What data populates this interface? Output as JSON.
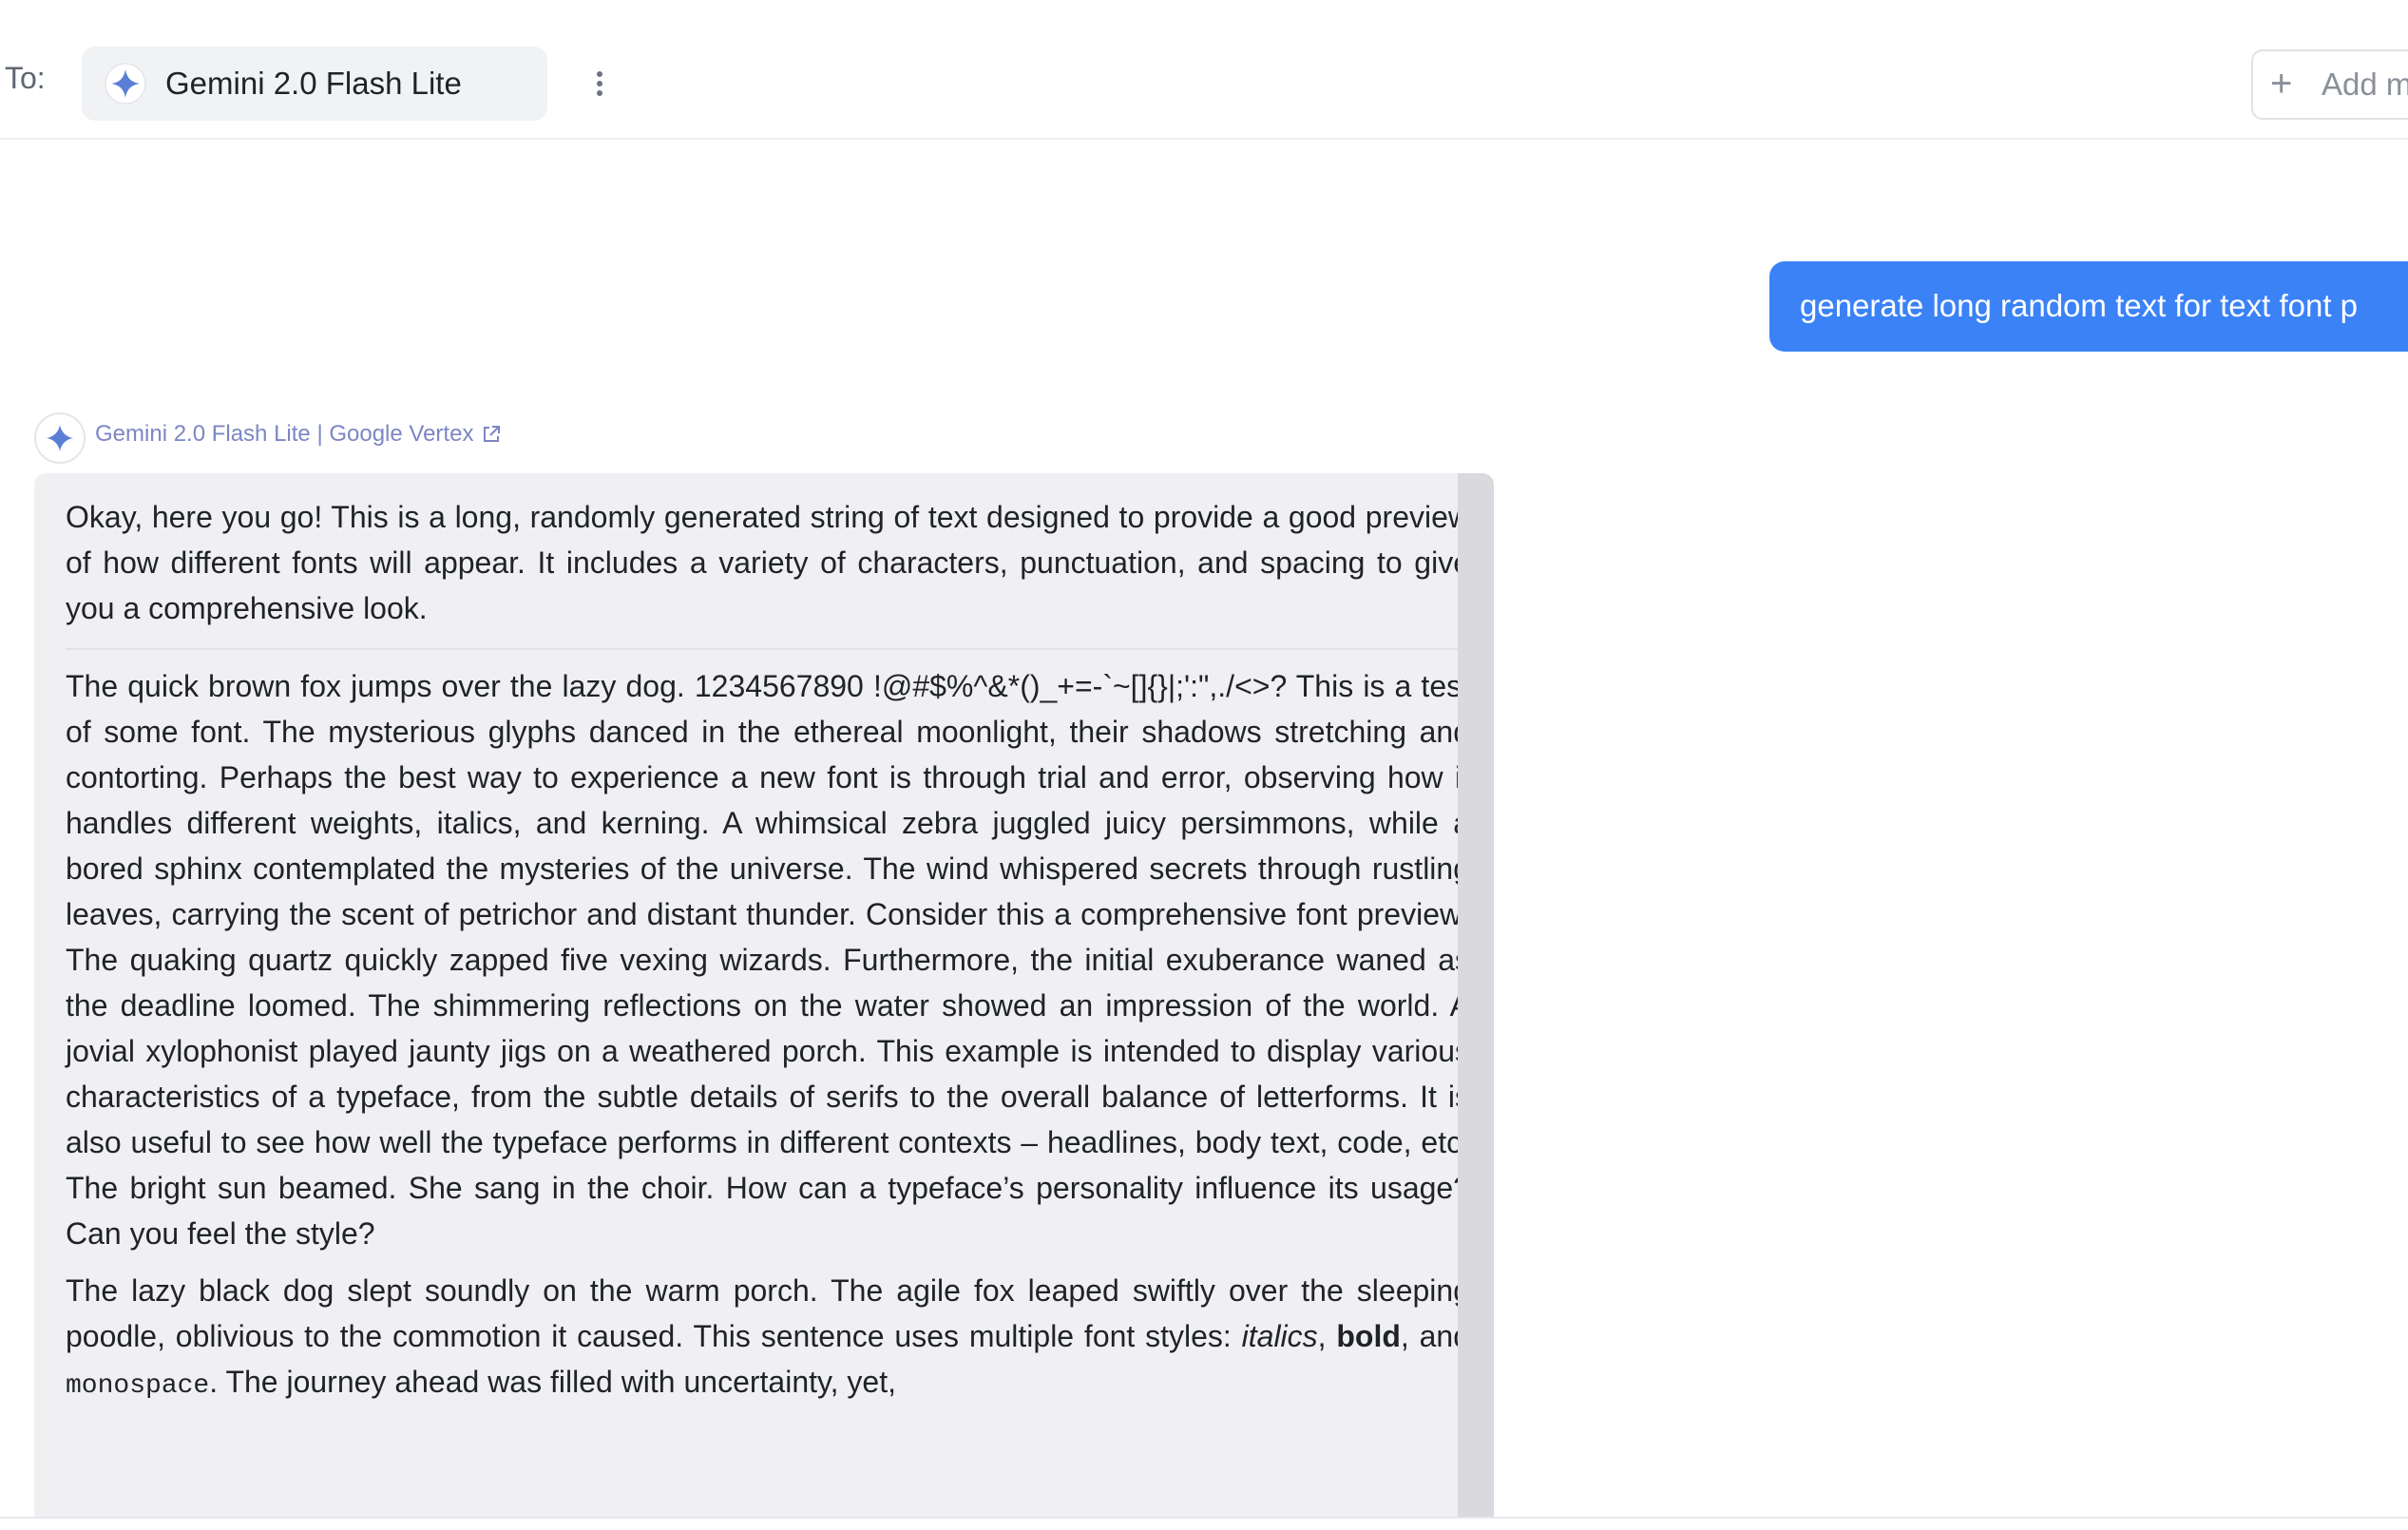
{
  "header": {
    "to_label": "To:",
    "model_name": "Gemini 2.0 Flash Lite",
    "add_model_label": "Add m"
  },
  "user_message": {
    "text": "generate long random text for text font p"
  },
  "assistant": {
    "meta": "Gemini 2.0 Flash Lite | Google Vertex",
    "paragraphs": [
      "Okay, here you go! This is a long, randomly generated string of text designed to provide a good preview of how different fonts will appear. It includes a variety of characters, punctuation, and spacing to give you a comprehensive look.",
      "The quick brown fox jumps over the lazy dog.  1234567890  !@#$%^&*()_+=-`~[]{}|;':\",./<>? This is a test of some font.  The mysterious glyphs danced in the ethereal moonlight, their shadows stretching and contorting.  Perhaps the best way to experience a new font is through trial and error, observing how it handles different weights, italics, and kerning. A whimsical zebra juggled juicy persimmons, while a bored sphinx contemplated the mysteries of the universe.  The wind whispered secrets through rustling leaves, carrying the scent of petrichor and distant thunder.  Consider this a comprehensive font preview! The quaking quartz quickly zapped five vexing wizards. Furthermore, the initial exuberance waned as the deadline loomed.  The shimmering reflections on the water showed an impression of the world.  A jovial xylophonist played jaunty jigs on a weathered porch. This example is intended to display various characteristics of a typeface, from the subtle details of serifs to the overall balance of letterforms.  It is also useful to see how well the typeface performs in different contexts – headlines, body text, code, etc. The bright sun beamed.  She sang in the choir.  How can a typeface’s personality influence its usage? Can you feel the style?"
    ],
    "para3": {
      "part1": "The lazy black dog slept soundly on the warm porch.  The agile fox leaped swiftly over the sleeping poodle, oblivious to the commotion it caused.  This sentence uses multiple font styles: ",
      "italics": "italics",
      "sep1": ", ",
      "bold": "bold",
      "sep2": ", and ",
      "mono": "monospace",
      "part2": ". The journey ahead was filled with uncertainty, yet,"
    }
  },
  "colors": {
    "accent": "#3b82f6",
    "response_bg": "#f0f0f2",
    "meta_text": "#7b87c4"
  },
  "icons": {
    "model": "gemini-sparkle-icon",
    "menu": "vertical-dots-icon",
    "add": "plus-icon",
    "external": "external-link-icon"
  }
}
